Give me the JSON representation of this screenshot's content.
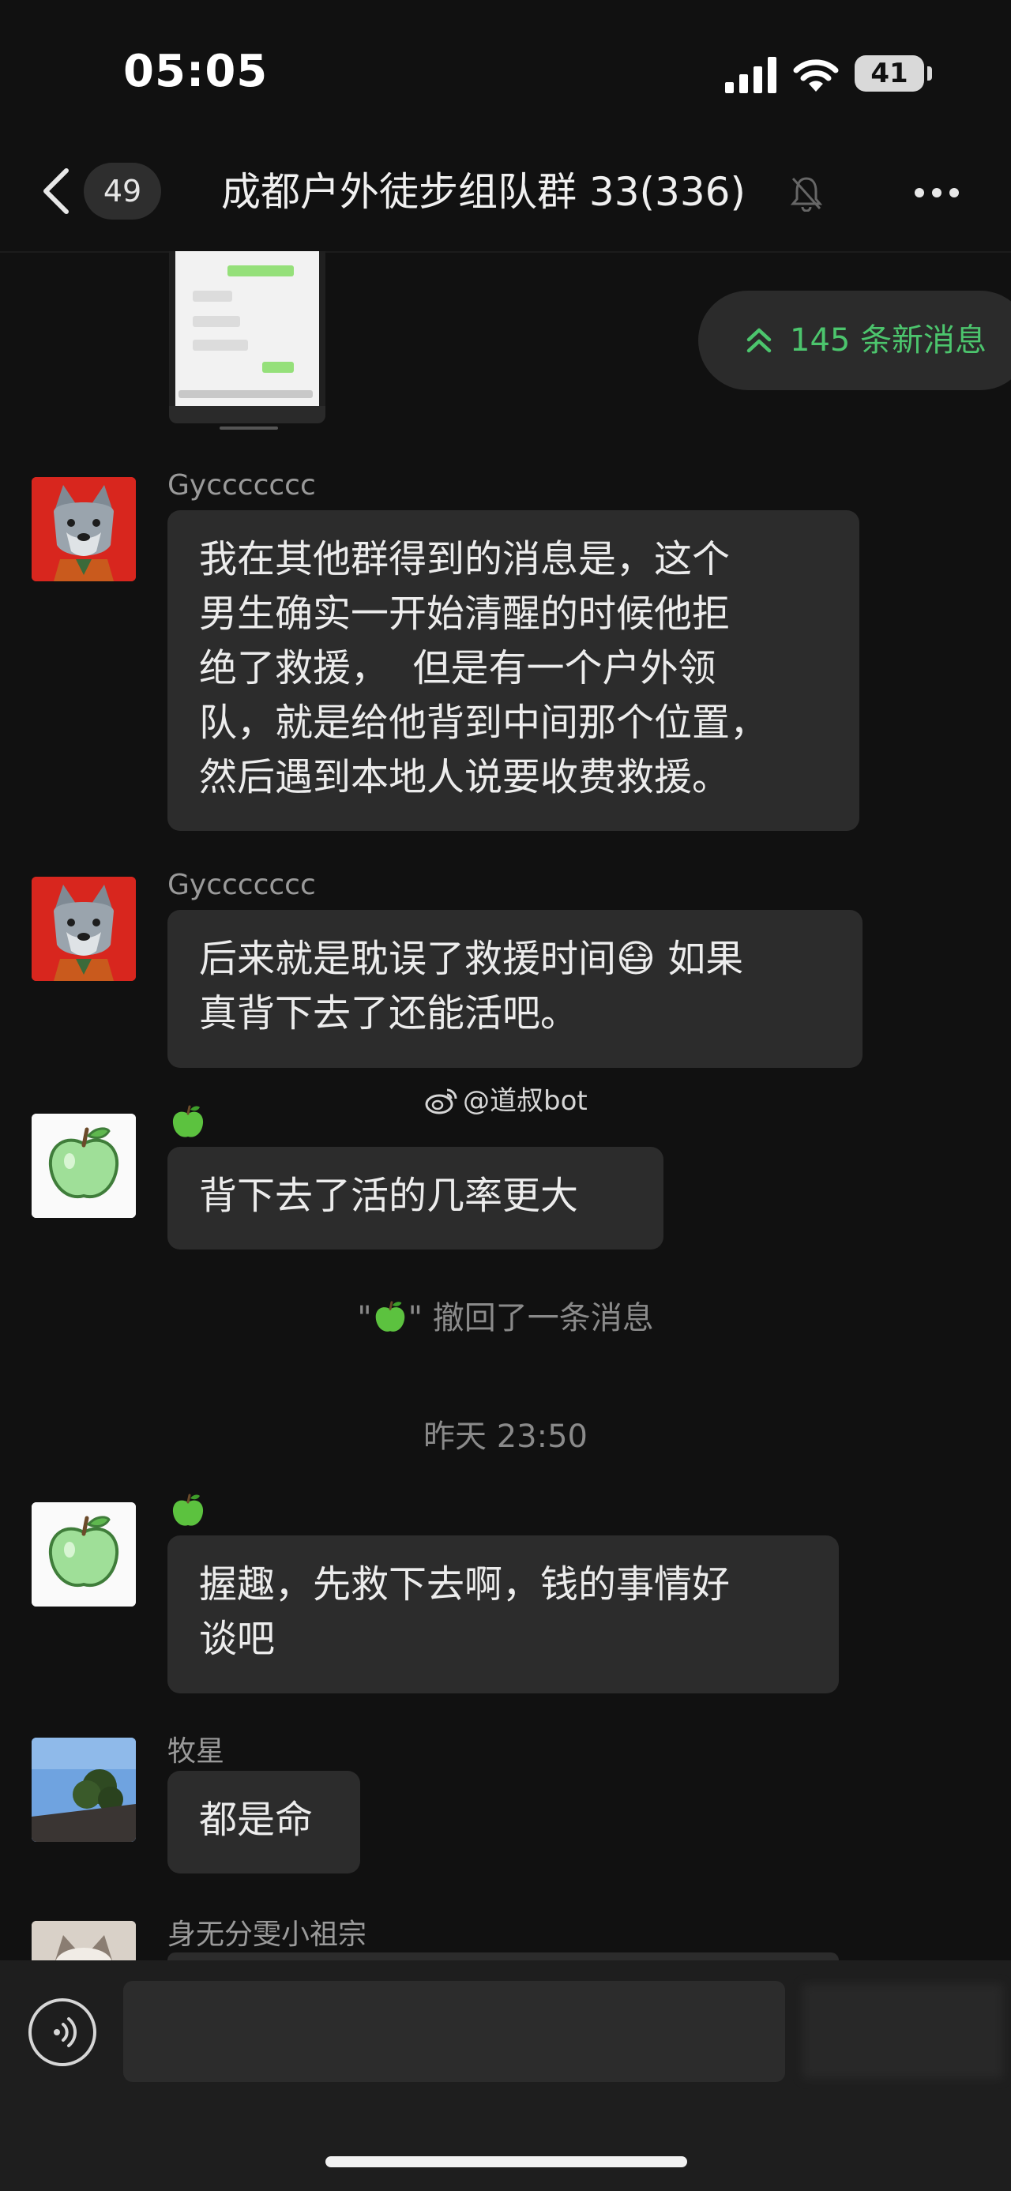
{
  "status_bar": {
    "time": "05:05",
    "battery": "41"
  },
  "header": {
    "back_count": "49",
    "title": "成都户外徒步组队群 33(336)"
  },
  "new_messages": {
    "label": "145 条新消息"
  },
  "messages": [
    {
      "sender": "Gyccccccc",
      "lines": [
        "我在其他群得到的消息是，这个",
        "男生确实一开始清醒的时候他拒",
        "绝了救援，  但是有一个户外领",
        "队，就是给他背到中间那个位置，",
        "然后遇到本地人说要收费救援。"
      ]
    },
    {
      "sender": "Gyccccccc",
      "lines": [
        "后来就是耽误了救援时间😷 如果",
        "真背下去了还能活吧。"
      ]
    },
    {
      "sender": "🍏",
      "lines": [
        "背下去了活的几率更大"
      ]
    },
    {
      "sender": "🍏",
      "lines": [
        "握趣，先救下去啊，钱的事情好",
        "谈吧"
      ]
    },
    {
      "sender": "牧星",
      "lines": [
        "都是命"
      ]
    },
    {
      "sender": "身无分雯小祖宗",
      "lines": []
    }
  ],
  "system": {
    "recall_prefix": "\"",
    "recall_suffix": "\" 撤回了一条消息",
    "timestamp": "昨天 23:50"
  },
  "watermark": "@道叔bot",
  "colors": {
    "accent_green": "#4cc56d",
    "bubble": "#2c2c2c",
    "background": "#111111"
  }
}
